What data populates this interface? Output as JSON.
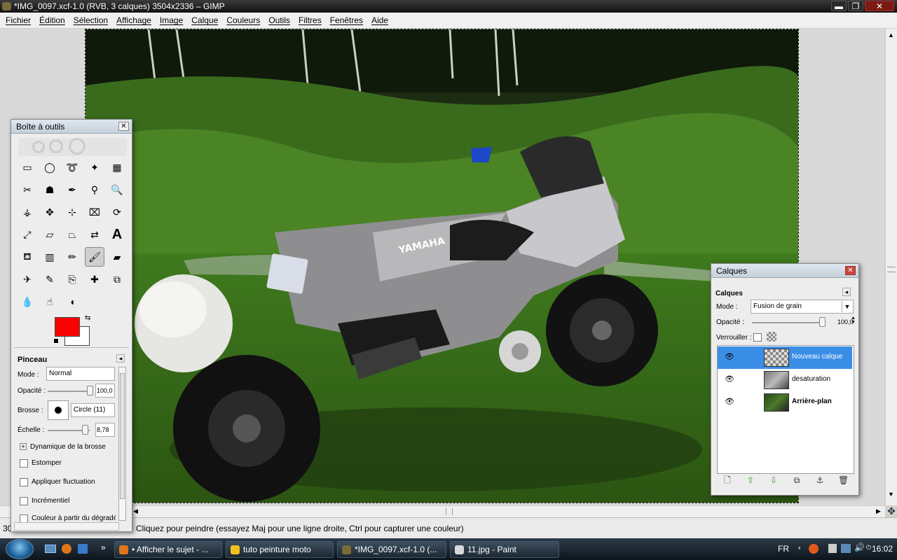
{
  "window": {
    "title": "*IMG_0097.xcf-1.0 (RVB, 3 calques) 3504x2336 – GIMP",
    "min": "▬",
    "max": "❐",
    "close": "✕"
  },
  "menubar": [
    "Fichier",
    "Édition",
    "Sélection",
    "Affichage",
    "Image",
    "Calque",
    "Couleurs",
    "Outils",
    "Filtres",
    "Fenêtres",
    "Aide"
  ],
  "toolbox": {
    "title": "Boîte à outils",
    "close": "✕",
    "tools": [
      {
        "name": "rect-select-icon",
        "glyph": "▭"
      },
      {
        "name": "ellipse-select-icon",
        "glyph": "◯"
      },
      {
        "name": "free-select-icon",
        "glyph": "➰"
      },
      {
        "name": "fuzzy-select-icon",
        "glyph": "✦"
      },
      {
        "name": "color-select-icon",
        "glyph": "▦"
      },
      {
        "name": "scissors-select-icon",
        "glyph": "✂"
      },
      {
        "name": "foreground-select-icon",
        "glyph": "☗"
      },
      {
        "name": "paths-icon",
        "glyph": "✒"
      },
      {
        "name": "color-picker-icon",
        "glyph": "⚲"
      },
      {
        "name": "zoom-icon",
        "glyph": "🔍"
      },
      {
        "name": "measure-icon",
        "glyph": "⚶"
      },
      {
        "name": "move-icon",
        "glyph": "✥"
      },
      {
        "name": "align-icon",
        "glyph": "⊹"
      },
      {
        "name": "crop-icon",
        "glyph": "⌧"
      },
      {
        "name": "rotate-icon",
        "glyph": "⟳"
      },
      {
        "name": "scale-icon",
        "glyph": "⤢"
      },
      {
        "name": "shear-icon",
        "glyph": "▱"
      },
      {
        "name": "perspective-icon",
        "glyph": "⏢"
      },
      {
        "name": "flip-icon",
        "glyph": "⇄"
      },
      {
        "name": "text-icon",
        "glyph": "A"
      },
      {
        "name": "bucket-fill-icon",
        "glyph": "⛾"
      },
      {
        "name": "blend-icon",
        "glyph": "▥"
      },
      {
        "name": "pencil-icon",
        "glyph": "✏"
      },
      {
        "name": "paintbrush-icon",
        "glyph": "🖌"
      },
      {
        "name": "eraser-icon",
        "glyph": "▰"
      },
      {
        "name": "airbrush-icon",
        "glyph": "✈"
      },
      {
        "name": "ink-icon",
        "glyph": "✎"
      },
      {
        "name": "clone-icon",
        "glyph": "⎘"
      },
      {
        "name": "heal-icon",
        "glyph": "✚"
      },
      {
        "name": "perspective-clone-icon",
        "glyph": "⧉"
      },
      {
        "name": "blur-icon",
        "glyph": "💧"
      },
      {
        "name": "smudge-icon",
        "glyph": "☝"
      },
      {
        "name": "dodge-burn-icon",
        "glyph": "◖"
      }
    ],
    "fg_color": "#ff0000",
    "bg_color": "#ffffff",
    "options": {
      "title": "Pinceau",
      "mode_label": "Mode :",
      "mode_value": "Normal",
      "opacity_label": "Opacité :",
      "opacity_value": "100,0",
      "opacity_level": 1.0,
      "brush_label": "Brosse :",
      "brush_value": "Circle (11)",
      "scale_label": "Échelle :",
      "scale_value": "8,78",
      "scale_level": 0.88,
      "dynamics_label": "Dynamique de la brosse",
      "fade_label": "Estomper",
      "jitter_label": "Appliquer fluctuation",
      "incremental_label": "Incrémentiel",
      "gradient_label": "Couleur à partir du dégradé"
    }
  },
  "layers_panel": {
    "title": "Calques",
    "tab": "Calques",
    "close": "✕",
    "mode_label": "Mode :",
    "mode_value": "Fusion de grain",
    "opacity_label": "Opacité :",
    "opacity_value": "100,0",
    "opacity_level": 1.0,
    "lock_label": "Verrouiller :",
    "layers": [
      {
        "name": "Nouveau calque",
        "selected": true,
        "bold": false
      },
      {
        "name": "desaturation",
        "selected": false,
        "bold": false
      },
      {
        "name": "Arrière-plan",
        "selected": false,
        "bold": true
      }
    ],
    "buttons": [
      "🗋",
      "⇧",
      "⇩",
      "⧉",
      "⚓",
      "🗑"
    ]
  },
  "statusbar": {
    "zoom": "30",
    "message": "Cliquez pour peindre (essayez Maj pour une ligne droite, Ctrl pour capturer une couleur)"
  },
  "taskbar": {
    "tasks": [
      {
        "label": "• Afficher le sujet - ...",
        "color": "#e0761a"
      },
      {
        "label": "tuto peinture moto",
        "color": "#f0c020"
      },
      {
        "label": "*IMG_0097.xcf-1.0 (...",
        "color": "#7a6a3a"
      },
      {
        "label": "11.jpg - Paint",
        "color": "#d8d8d8"
      }
    ],
    "lang": "FR",
    "clock": "16:02"
  }
}
